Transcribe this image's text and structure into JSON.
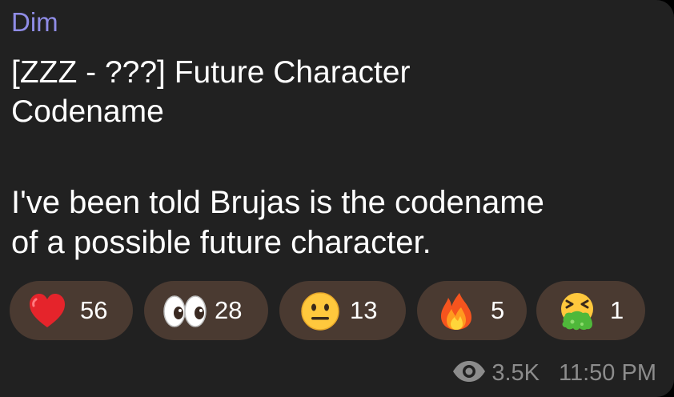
{
  "message": {
    "sender": "Dim",
    "title_line1": "[ZZZ - ???] Future Character",
    "title_line2": "Codename",
    "body_line1": "I've been told Brujas is the codename",
    "body_line2": "of a possible future character.",
    "views": "3.5K",
    "time": "11:50 PM"
  },
  "reactions": [
    {
      "icon": "red-heart-icon",
      "count": "56"
    },
    {
      "icon": "eyes-icon",
      "count": "28"
    },
    {
      "icon": "neutral-face-icon",
      "count": "13"
    },
    {
      "icon": "fire-icon",
      "count": "5"
    },
    {
      "icon": "vomiting-face-icon",
      "count": "1"
    }
  ],
  "colors": {
    "bubble_bg": "#212121",
    "sender": "#8f8ce6",
    "reaction_bg": "#4a3a31",
    "meta_text": "#8c8c8c"
  }
}
